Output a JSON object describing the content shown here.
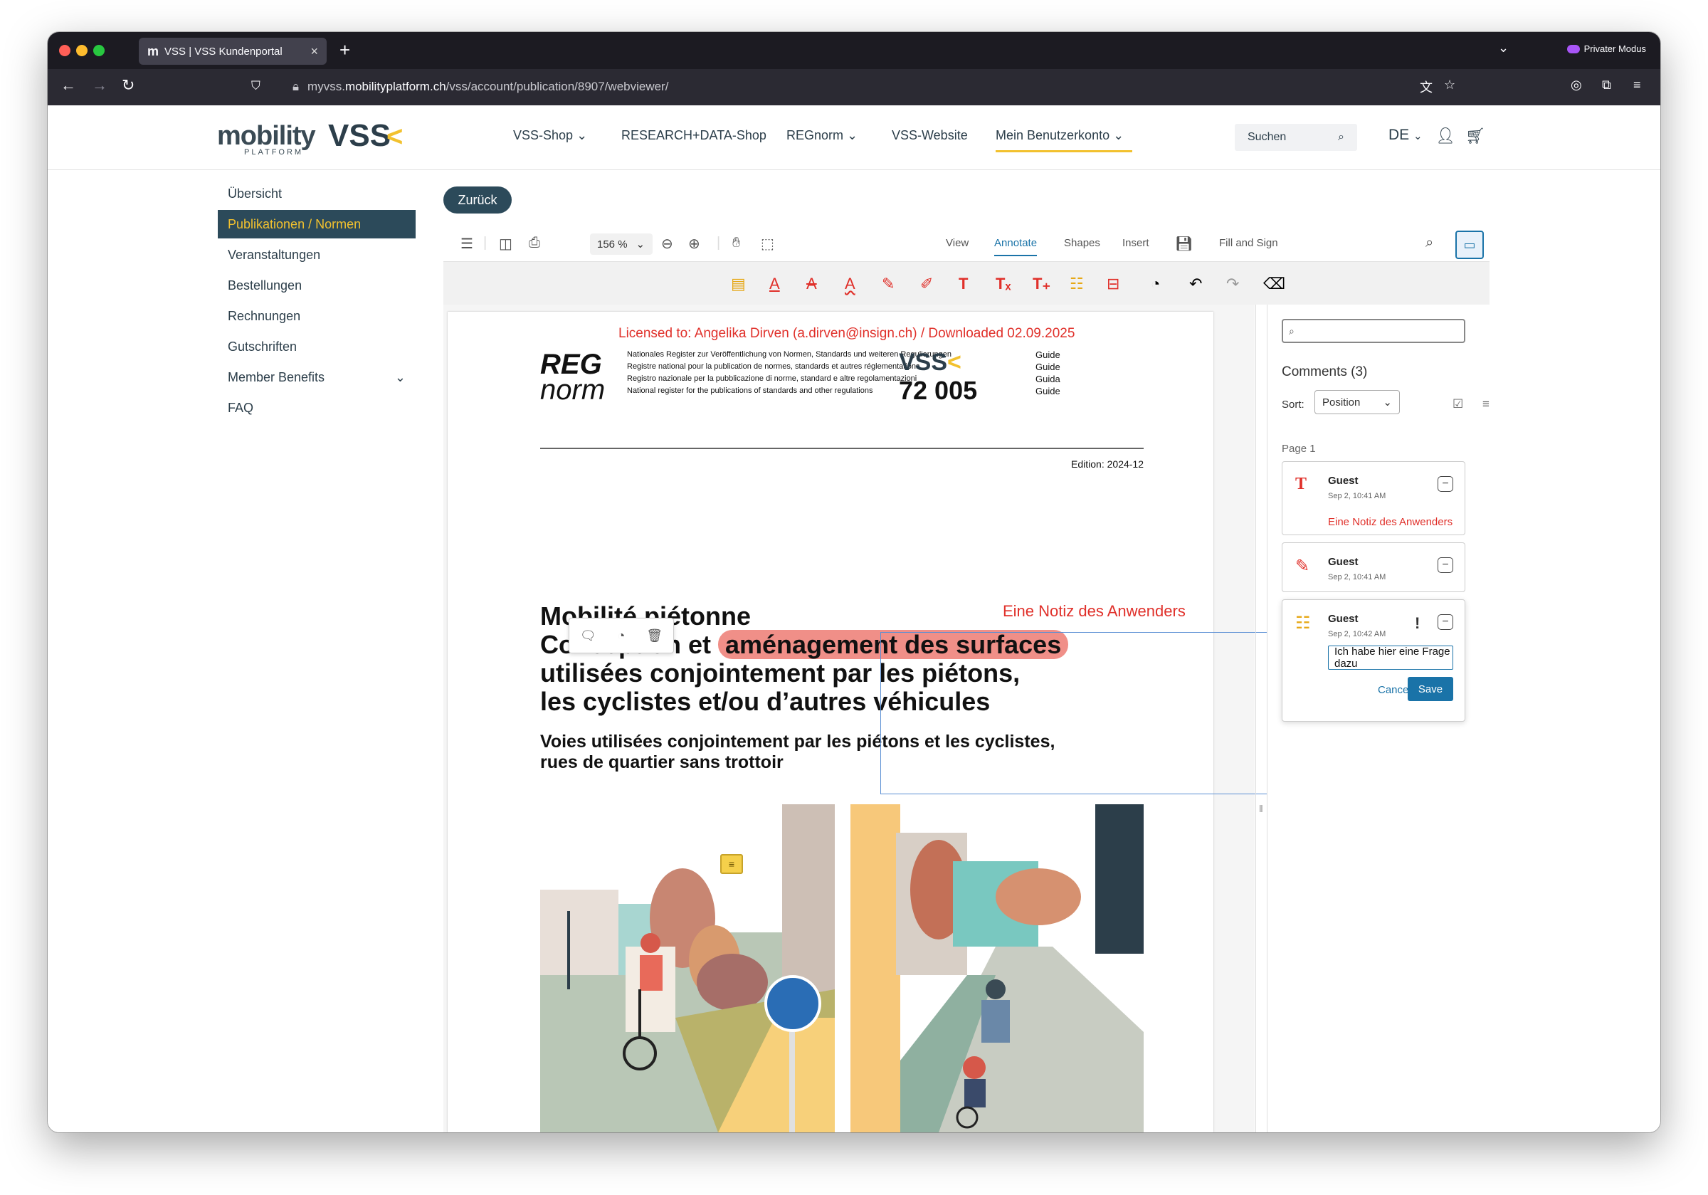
{
  "browser": {
    "tab_title": "VSS | VSS Kundenportal",
    "tab_favicon": "m",
    "close_symbol": "×",
    "new_tab_symbol": "+",
    "private_mode": "Privater Modus",
    "url_prefix": "myvss.",
    "url_host": "mobilityplatform.ch",
    "url_path": "/vss/account/publication/8907/webviewer/"
  },
  "site": {
    "logo_mobility": "mobility",
    "logo_platform": "PLATFORM",
    "logo_vss": "VSS",
    "nav": [
      "VSS-Shop",
      "RESEARCH+DATA-Shop",
      "REGnorm",
      "VSS-Website",
      "Mein Benutzerkonto"
    ],
    "search_placeholder": "Suchen",
    "language": "DE"
  },
  "sidebar": {
    "items": [
      {
        "label": "Übersicht"
      },
      {
        "label": "Publikationen / Normen"
      },
      {
        "label": "Veranstaltungen"
      },
      {
        "label": "Bestellungen"
      },
      {
        "label": "Rechnungen"
      },
      {
        "label": "Gutschriften"
      },
      {
        "label": "Member Benefits"
      },
      {
        "label": "FAQ"
      }
    ]
  },
  "viewer": {
    "back_label": "Zurück",
    "zoom": "156 %",
    "tabs": [
      "View",
      "Annotate",
      "Shapes",
      "Insert",
      "Fill and Sign"
    ],
    "active_tab": "Annotate"
  },
  "document": {
    "license": "Licensed to: Angelika Dirven (a.dirven@insign.ch) / Downloaded 02.09.2025",
    "reg_line1": "REG",
    "reg_line2": "norm",
    "registry_lines": [
      "Nationales Register zur Veröffentlichung von Normen, Standards und weiteren Regulierungen",
      "Registre national pour la publication de normes, standards et autres réglementations",
      "Registro nazionale per la pubblicazione di norme, standard e altre regolamentazioni",
      "National register for the publications of standards and other regulations"
    ],
    "vss_logo": "VSS",
    "doc_number": "72 005",
    "guide_labels": [
      "Guide",
      "Guide",
      "Guida",
      "Guide"
    ],
    "edition": "Edition: 2024-12",
    "title_line1": "Mobilité piétonne",
    "title_line2_prefix": "Conception et ",
    "title_line2_highlight": "aménagement des surfaces",
    "title_line3": "utilisées conjointement par les piétons,",
    "title_line4": "les cyclistes et/ou d’autres véhicules",
    "subtitle_line1": "Voies utilisées conjointement par les piétons et les cyclistes,",
    "subtitle_line2": "rues de quartier sans trottoir",
    "free_text_note": "Eine Notiz des Anwenders",
    "highlight_color": "#f08f88",
    "annotation_color": "#e0302a"
  },
  "comments": {
    "title": "Comments (3)",
    "sort_label": "Sort:",
    "sort_value": "Position",
    "page_label": "Page 1",
    "items": [
      {
        "author": "Guest",
        "time": "Sep 2, 10:41 AM",
        "text": "Eine Notiz des Anwenders",
        "icon": "text-T-icon"
      },
      {
        "author": "Guest",
        "time": "Sep 2, 10:41 AM",
        "text": "",
        "icon": "pen-icon"
      },
      {
        "author": "Guest",
        "time": "Sep 2, 10:42 AM",
        "text": "",
        "icon": "sticky-note-icon",
        "reply_value": "Ich habe hier eine Frage dazu",
        "priority": "!"
      }
    ],
    "cancel_label": "Cancel",
    "save_label": "Save",
    "accent": "#1a73a8"
  }
}
